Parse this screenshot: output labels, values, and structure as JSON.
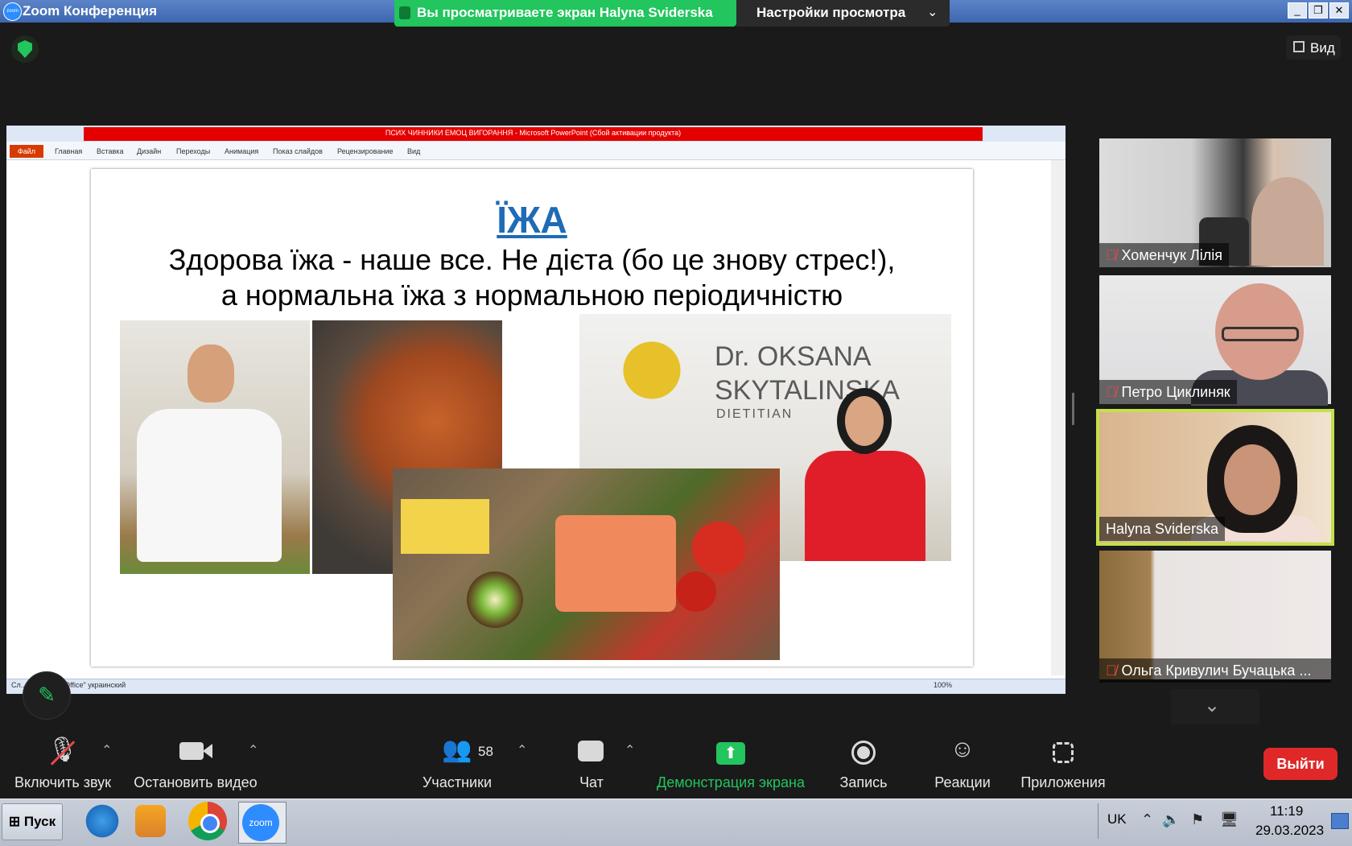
{
  "window": {
    "title": "Zoom Конференция",
    "logo_text": "zoom"
  },
  "share_banner": {
    "text": "Вы просматриваете экран Halyna Sviderska"
  },
  "view_options": {
    "label": "Настройки просмотра"
  },
  "view_button": {
    "label": "Вид"
  },
  "presentation": {
    "window_title": "ПСИХ ЧИННИКИ ЕМОЦ ВИГОРАННЯ - Microsoft PowerPoint (Сбой активации продукта)",
    "file_tab": "Файл",
    "tabs": [
      "Главная",
      "Вставка",
      "Дизайн",
      "Переходы",
      "Анимация",
      "Показ слайдов",
      "Рецензирование",
      "Вид"
    ],
    "status": "Сл... 2   \"2_Тема Office\"   украинский",
    "zoom": "100%",
    "slide": {
      "heading": "ЇЖА",
      "line1": "Здорова їжа - наше все. Не дієта (бо це знову стрес!),",
      "line2": "а нормальна їжа з нормальною періодичністю",
      "sign_line1": "Dr. OKSANA",
      "sign_line2": "SKYTALINSKA",
      "sign_line3": "DIETITIAN"
    }
  },
  "participants": [
    {
      "name": "Хоменчук Лілія",
      "muted": true
    },
    {
      "name": "Петро Циклиняк",
      "muted": true
    },
    {
      "name": "Halyna Sviderska",
      "muted": false,
      "active_speaker": true
    },
    {
      "name": "Ольга Кривулич Бучацька ...",
      "muted": true
    }
  ],
  "toolbar": {
    "audio_label": "Включить звук",
    "video_label": "Остановить видео",
    "participants_label": "Участники",
    "participants_count": "58",
    "chat_label": "Чат",
    "share_label": "Демонстрация экрана",
    "record_label": "Запись",
    "reactions_label": "Реакции",
    "apps_label": "Приложения",
    "leave_label": "Выйти"
  },
  "taskbar": {
    "start_label": "Пуск",
    "lang": "UK",
    "time": "11:19",
    "date": "29.03.2023"
  },
  "colors": {
    "share_green": "#22c55e",
    "leave_red": "#e02828",
    "speaker_border": "#c4e04a"
  }
}
